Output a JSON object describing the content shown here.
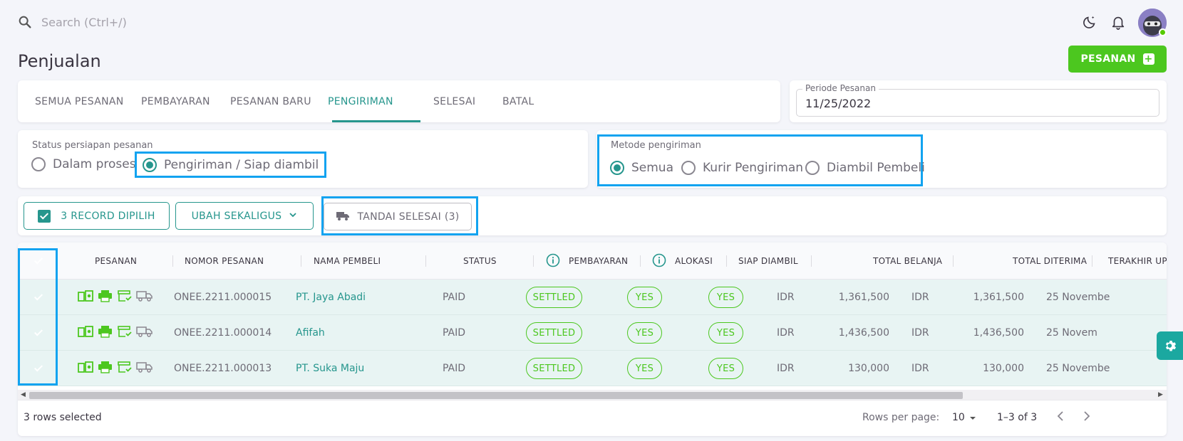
{
  "search": {
    "placeholder": "Search (Ctrl+/)"
  },
  "header": {
    "title": "Penjualan",
    "new_order_label": "PESANAN"
  },
  "tabs": [
    "SEMUA PESANAN",
    "PEMBAYARAN",
    "PESANAN BARU",
    "PENGIRIMAN",
    "SELESAI",
    "BATAL"
  ],
  "active_tab": "PENGIRIMAN",
  "period": {
    "label": "Periode Pesanan",
    "value": "11/25/2022"
  },
  "status_filter": {
    "label": "Status persiapan pesanan",
    "options": [
      "Dalam proses",
      "Pengiriman / Siap diambil"
    ],
    "selected": "Pengiriman / Siap diambil"
  },
  "shipping_filter": {
    "label": "Metode pengiriman",
    "options": [
      "Semua",
      "Kurir Pengiriman",
      "Diambil Pembeli"
    ],
    "selected": "Semua"
  },
  "actions": {
    "records_selected": "3 RECORD DIPILIH",
    "bulk_edit": "UBAH SEKALIGUS",
    "mark_done": "TANDAI SELESAI (3)"
  },
  "table": {
    "headers": {
      "pesanan": "PESANAN",
      "nomor": "NOMOR PESANAN",
      "nama": "NAMA PEMBELI",
      "status": "STATUS",
      "pembayaran": "PEMBAYARAN",
      "alokasi": "ALOKASI",
      "siap": "SIAP DIAMBIL",
      "total_belanja": "TOTAL BELANJA",
      "total_diterima": "TOTAL DITERIMA",
      "terakhir": "TERAKHIR UPI"
    },
    "rows": [
      {
        "order_no": "ONEE.2211.000015",
        "buyer": "PT. Jaya Abadi",
        "status": "PAID",
        "payment": "SETTLED",
        "allocation": "YES",
        "ready": "YES",
        "cur1": "IDR",
        "total_spent": "1,361,500",
        "cur2": "IDR",
        "total_received": "1,361,500",
        "updated": "25 Novembe"
      },
      {
        "order_no": "ONEE.2211.000014",
        "buyer": "Afifah",
        "status": "PAID",
        "payment": "SETTLED",
        "allocation": "YES",
        "ready": "YES",
        "cur1": "IDR",
        "total_spent": "1,436,500",
        "cur2": "IDR",
        "total_received": "1,436,500",
        "updated": "25 Novem"
      },
      {
        "order_no": "ONEE.2211.000013",
        "buyer": "PT. Suka Maju",
        "status": "PAID",
        "payment": "SETTLED",
        "allocation": "YES",
        "ready": "YES",
        "cur1": "IDR",
        "total_spent": "130,000",
        "cur2": "IDR",
        "total_received": "130,000",
        "updated": "25 Novembe"
      }
    ]
  },
  "footer": {
    "rows_selected": "3 rows selected",
    "rows_per_page_label": "Rows per page:",
    "rows_per_page": "10",
    "range": "1–3 of 3"
  },
  "colors": {
    "primary": "#26968d",
    "success": "#4cc71f",
    "highlight": "#12a3f0"
  }
}
